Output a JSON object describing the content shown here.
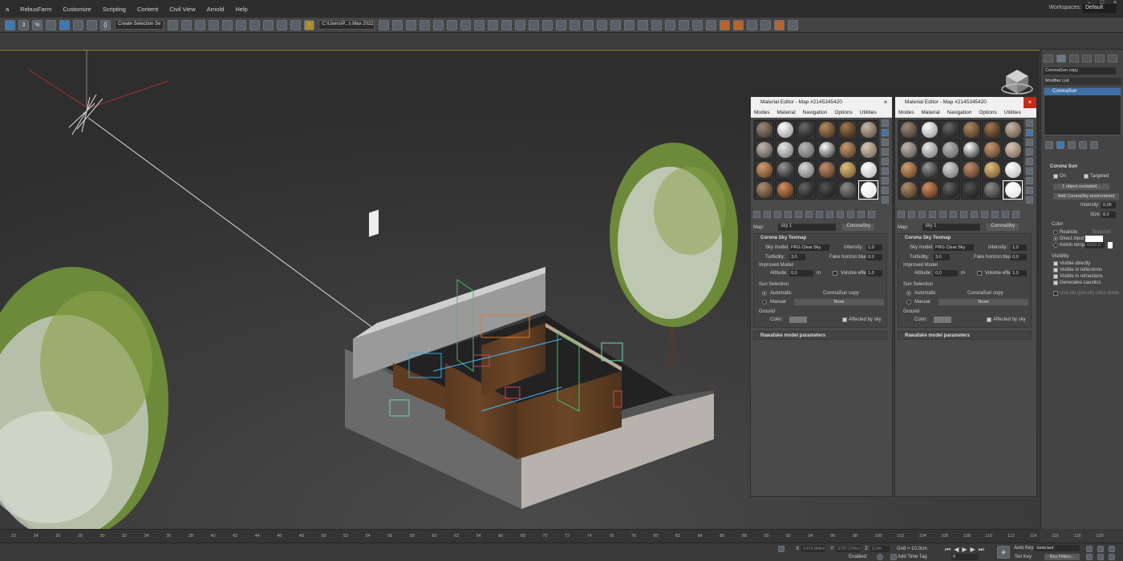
{
  "menubar": {
    "items": [
      "a",
      "RebusFarm",
      "Customize",
      "Scripting",
      "Content",
      "Civil View",
      "Arnold",
      "Help"
    ],
    "workspaces_label": "Workspaces:",
    "workspace_value": "Default"
  },
  "toolbar": {
    "ref_coord": "Create Selection Se",
    "project_path": "C:\\Users\\P...s Max 2022"
  },
  "material_editor_1": {
    "title": "Material Editor - Map #2145345420",
    "menus": [
      "Modes",
      "Material",
      "Navigation",
      "Options",
      "Utilities"
    ],
    "map_label": "Map:",
    "map_name": "sky 1",
    "map_type": "CoronaSky"
  },
  "material_editor_2": {
    "title": "Material Editor - Map #2145345420",
    "menus": [
      "Modes",
      "Material",
      "Navigation",
      "Options",
      "Utilities"
    ],
    "map_label": "Map:",
    "map_name": "sky 1",
    "map_type": "CoronaSky"
  },
  "sky_rollout": {
    "header": "Corona Sky Texmap",
    "sky_model_label": "Sky model:",
    "sky_model_value": "PRG Clear Sky",
    "intensity_label": "Intensity:",
    "intensity_value": "1,0",
    "turbidity_label": "Turbidity:",
    "turbidity_value": "3,0",
    "fake_horizon_label": "Fake horizon blur:",
    "fake_horizon_value": "0,0",
    "improved_model": "Improved Model",
    "altitude_label": "Altitude:",
    "altitude_value": "0,0",
    "altitude_unit": "m",
    "volume_effect_label": "Volume effect",
    "volume_effect_value": "1,0",
    "sun_selection": "Sun Selection",
    "automatic_label": "Automatic",
    "automatic_value": "CoronaSun copy",
    "manual_label": "Manual",
    "manual_value": "None",
    "ground": "Ground",
    "color_label": "Color:",
    "affected_by_sky": "Affected by sky",
    "rawafake_header": "Rawafake model parameters"
  },
  "command_panel": {
    "object_name": "CoronaSun copy",
    "modifier_list": "Modifier List",
    "stack_item": "CoronaSun",
    "rollout_title": "Corona Sun",
    "on_label": "On",
    "targeted_label": "Targeted",
    "excluded_btn": "1 object excluded...",
    "add_env_btn": "Add CoronaSky environment",
    "intensity_label": "Intensity:",
    "intensity_value": "0,05",
    "size_label": "Size:",
    "size_value": "8,0",
    "color_title": "Color",
    "realistic": "Realistic",
    "textured": "Textured",
    "direct_input": "Direct input",
    "kelvin_temp": "Kelvin temp",
    "kelvin_value": "6500,0",
    "visibility_title": "Visibility",
    "visible_directly": "Visible directly",
    "visible_reflections": "Visible in reflections",
    "visible_refractions": "Visible in refractions",
    "generates_caustics": "Generates caustics",
    "use_old": "Use old (pre-v6) color mode"
  },
  "timeline": {
    "ticks": [
      "22",
      "24",
      "26",
      "28",
      "30",
      "32",
      "34",
      "36",
      "38",
      "40",
      "42",
      "44",
      "46",
      "48",
      "50",
      "52",
      "54",
      "56",
      "58",
      "60",
      "62",
      "64",
      "66",
      "68",
      "70",
      "72",
      "74",
      "76",
      "78",
      "80",
      "82",
      "84",
      "86",
      "88",
      "90",
      "92",
      "94",
      "96",
      "98",
      "100",
      "102",
      "104",
      "106",
      "108",
      "110",
      "112",
      "114",
      "116",
      "118",
      "120"
    ]
  },
  "status": {
    "x_label": "X:",
    "x_value": "1474,964m",
    "y_label": "Y:",
    "y_value": "3787,078m",
    "z_label": "Z:",
    "z_value": "0,0m",
    "grid": "Grid = 10,0cm",
    "enabled": "Enabled:",
    "add_time_tag": "Add Time Tag",
    "frame_value": "0",
    "auto_key": "Auto Key",
    "set_key": "Set Key",
    "selected": "Selected",
    "key_filters": "Key Filters..."
  }
}
